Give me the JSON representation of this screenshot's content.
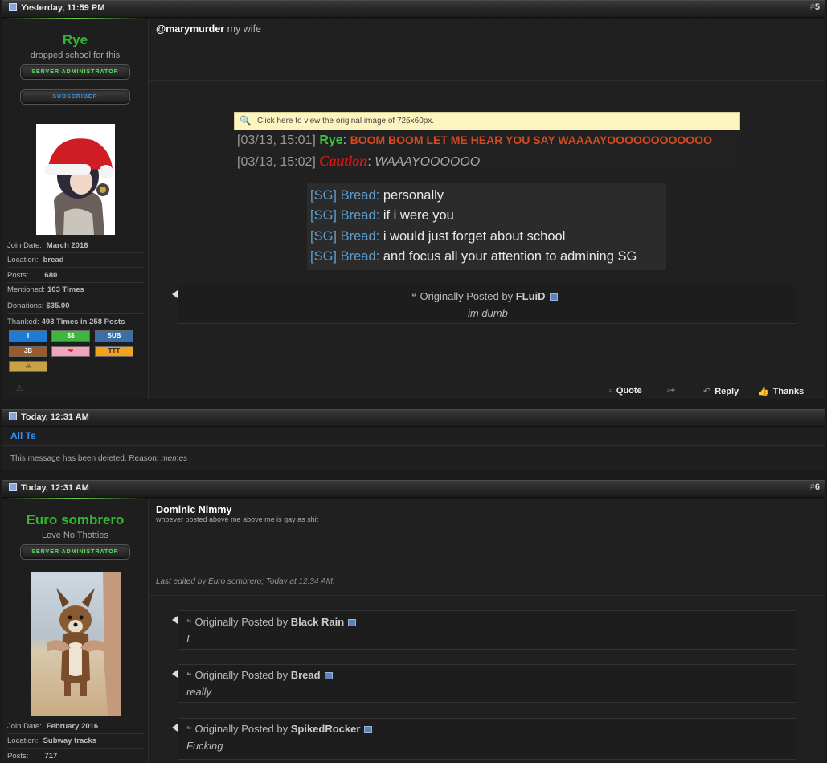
{
  "post1": {
    "date": "Yesterday, 11:59 PM",
    "number": "5",
    "user": {
      "name": "Rye",
      "title": "dropped school for this",
      "rank1": "SERVER ADMINISTRATOR",
      "rank2": "SUBSCRIBER",
      "join_label": "Join Date:",
      "join": "March 2016",
      "loc_label": "Location:",
      "loc": "bread",
      "posts_label": "Posts:",
      "posts": "680",
      "mentioned_label": "Mentioned:",
      "mentioned": "103 Times",
      "donations_label": "Donations:",
      "donations": "$35.00",
      "thanked_label": "Thanked:",
      "thanked": "493 Times in 258 Posts",
      "badges": [
        "I",
        "$$",
        "SUB",
        "JB",
        "❤",
        "TTT",
        "☠"
      ]
    },
    "mention": "@marymurder",
    "message": "my wife",
    "image_banner": "Click here to view the original image of 725x60px.",
    "chat1": {
      "time": "[03/13, 15:01]",
      "name": "Rye",
      "sep": ":",
      "text": "BOOM BOOM LET ME HEAR YOU SAY WAAAAYOOOOOOOOOOOO"
    },
    "chat2": {
      "time": "[03/13, 15:02]",
      "name": "Caution",
      "sep": ":",
      "text": "WAAAYOOOOOO"
    },
    "bread_lines": [
      {
        "tag": "[SG] Bread",
        "text": "personally"
      },
      {
        "tag": "[SG] Bread",
        "text": "if i were you"
      },
      {
        "tag": "[SG] Bread",
        "text": "i would just forget about school"
      },
      {
        "tag": "[SG] Bread",
        "text": "and focus all your attention to admining SG"
      }
    ],
    "quote": {
      "prefix": "Originally Posted by",
      "author": "FLuiD",
      "text": "im dumb"
    },
    "actions": {
      "quote": "Quote",
      "reply": "Reply",
      "thanks": "Thanks"
    }
  },
  "deleted": {
    "date": "Today, 12:31 AM",
    "user": "All Ts",
    "text": "This message has been deleted. Reason:",
    "reason": "memes"
  },
  "post2": {
    "date": "Today, 12:31 AM",
    "number": "6",
    "user": {
      "name": "Euro sombrero",
      "title": "Love No Thotties",
      "rank1": "SERVER ADMINISTRATOR",
      "join_label": "Join Date:",
      "join": "February 2016",
      "loc_label": "Location:",
      "loc": "Subway tracks",
      "posts_label": "Posts:",
      "posts": "717"
    },
    "title": "Dominic Nimmy",
    "subtitle": "whoever posted above me above me is gay as shit",
    "edited_prefix": "Last edited by Euro sombrero; Today at",
    "edited_time": "12:34 AM.",
    "quotes": [
      {
        "prefix": "Originally Posted by",
        "author": "Black Rain",
        "text": "I"
      },
      {
        "prefix": "Originally Posted by",
        "author": "Bread",
        "text": "really"
      },
      {
        "prefix": "Originally Posted by",
        "author": "SpikedRocker",
        "text": "Fucking"
      }
    ]
  }
}
